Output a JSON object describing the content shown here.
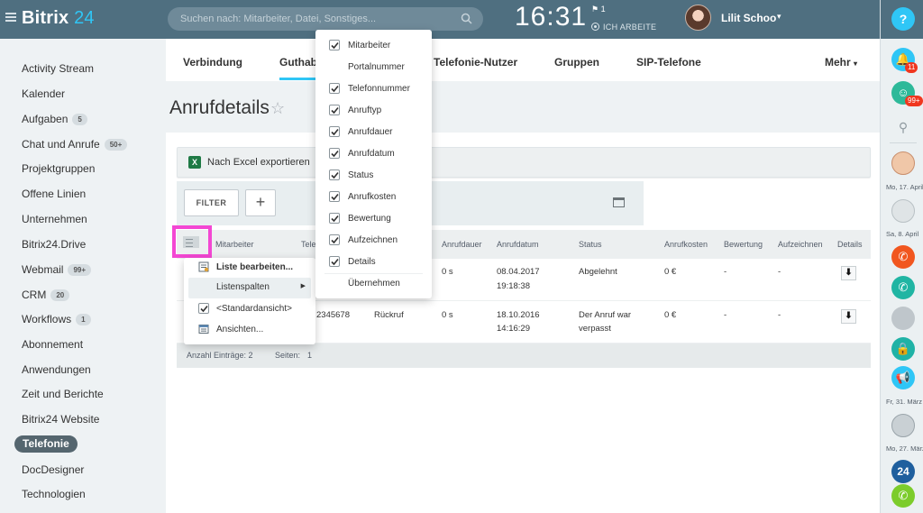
{
  "header": {
    "brand_name": "Bitrix",
    "brand_number": "24",
    "search_placeholder": "Suchen nach: Mitarbeiter, Datei, Sonstiges...",
    "clock": "16:31",
    "flag_count": "1",
    "work_status": "ICH ARBEITE",
    "user_name": "Lilit Schoo"
  },
  "sidebar": {
    "items": [
      {
        "label": "Activity Stream",
        "badge": ""
      },
      {
        "label": "Kalender",
        "badge": ""
      },
      {
        "label": "Aufgaben",
        "badge": "5"
      },
      {
        "label": "Chat und Anrufe",
        "badge": "50+"
      },
      {
        "label": "Projektgruppen",
        "badge": ""
      },
      {
        "label": "Offene Linien",
        "badge": ""
      },
      {
        "label": "Unternehmen",
        "badge": ""
      },
      {
        "label": "Bitrix24.Drive",
        "badge": ""
      },
      {
        "label": "Webmail",
        "badge": "99+"
      },
      {
        "label": "CRM",
        "badge": "20"
      },
      {
        "label": "Workflows",
        "badge": "1"
      },
      {
        "label": "Abonnement",
        "badge": ""
      },
      {
        "label": "Anwendungen",
        "badge": ""
      },
      {
        "label": "Zeit und Berichte",
        "badge": ""
      },
      {
        "label": "Bitrix24 Website",
        "badge": ""
      },
      {
        "label": "Telefonie",
        "badge": ""
      },
      {
        "label": "DocDesigner",
        "badge": ""
      },
      {
        "label": "Technologien",
        "badge": ""
      }
    ]
  },
  "tabs": {
    "verbindung": "Verbindung",
    "guthaben": "Guthab",
    "telefonie_nutzer": "Telefonie-Nutzer",
    "gruppen": "Gruppen",
    "sip": "SIP-Telefone",
    "mehr": "Mehr"
  },
  "page": {
    "title": "Anrufdetails",
    "excel_export": "Nach Excel exportieren",
    "filter_label": "FILTER",
    "plus_label": "+"
  },
  "grid": {
    "headers": {
      "mitarbeiter": "Mitarbeiter",
      "telefon": "Tele",
      "anrufdauer": "Anrufdauer",
      "anrufdatum": "Anrufdatum",
      "status": "Status",
      "anrufkosten": "Anrufkosten",
      "bewertung": "Bewertung",
      "aufzeichnen": "Aufzeichnen",
      "details": "Details"
    },
    "rows": [
      {
        "telefon": "",
        "typ": "",
        "dauer": "0 s",
        "datum": "08.04.2017",
        "zeit": "19:18:38",
        "status1": "Abgelehnt",
        "status2": "",
        "kosten": "0 €",
        "bewertung": "-",
        "aufzeichnen": "-"
      },
      {
        "telefon": "2345678",
        "typ": "Rückruf",
        "dauer": "0 s",
        "datum": "18.10.2016",
        "zeit": "14:16:29",
        "status1": "Der Anruf war",
        "status2": "verpasst",
        "kosten": "0 €",
        "bewertung": "-",
        "aufzeichnen": "-"
      }
    ],
    "footer_count": "Anzahl Einträge: 2",
    "footer_pages_label": "Seiten:",
    "footer_pages_value": "1"
  },
  "settings_menu": {
    "items": [
      {
        "label": "Liste bearbeiten...",
        "bold": true
      },
      {
        "label": "Listenspalten",
        "bold": false
      },
      {
        "label": "<Standardansicht>",
        "bold": false
      },
      {
        "label": "Ansichten...",
        "bold": false
      }
    ]
  },
  "columns_menu": {
    "items": [
      {
        "label": "Mitarbeiter",
        "checked": true
      },
      {
        "label": "Portalnummer",
        "checked": false
      },
      {
        "label": "Telefonnummer",
        "checked": true
      },
      {
        "label": "Anruftyp",
        "checked": true
      },
      {
        "label": "Anrufdauer",
        "checked": true
      },
      {
        "label": "Anrufdatum",
        "checked": true
      },
      {
        "label": "Status",
        "checked": true
      },
      {
        "label": "Anrufkosten",
        "checked": true
      },
      {
        "label": "Bewertung",
        "checked": true
      },
      {
        "label": "Aufzeichnen",
        "checked": true
      },
      {
        "label": "Details",
        "checked": true
      }
    ],
    "apply_label": "Übernehmen"
  },
  "right_panel": {
    "notifications_badge": "11",
    "chat_badge": "99+",
    "dates": [
      "Mo, 17. April",
      "Sa, 8. April",
      "Fr, 31. März",
      "Mo, 27. März"
    ],
    "help_label": "?",
    "bitrix_label": "24"
  },
  "colors": {
    "accent": "#2fc6f6",
    "header_bg": "#4f6f80",
    "highlight": "#f347d3",
    "badge_red": "#f0371f"
  }
}
